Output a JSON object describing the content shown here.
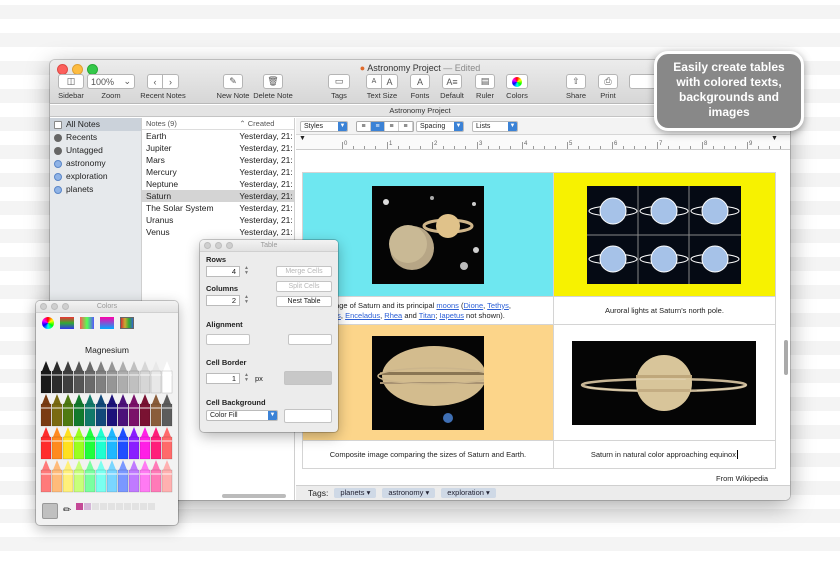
{
  "window": {
    "title": "Astronomy Project",
    "edited": "— Edited",
    "document_strip": "Astronomy Project"
  },
  "toolbar": {
    "sidebar_label": "Sidebar",
    "zoom_value": "100%",
    "zoom_label": "Zoom",
    "recent_label": "Recent Notes",
    "new_note_label": "New Note",
    "delete_note_label": "Delete Note",
    "tags_label": "Tags",
    "text_size_label": "Text Size",
    "fonts_label": "Fonts",
    "default_label": "Default",
    "ruler_label": "Ruler",
    "colors_label": "Colors",
    "share_label": "Share",
    "print_label": "Print"
  },
  "sidebar": {
    "items": [
      {
        "label": "All Notes",
        "icon": "notes-icon"
      },
      {
        "label": "Recents",
        "icon": "gear-icon"
      },
      {
        "label": "Untagged",
        "icon": "gear-icon"
      },
      {
        "label": "astronomy",
        "icon": "tag-icon"
      },
      {
        "label": "exploration",
        "icon": "tag-icon"
      },
      {
        "label": "planets",
        "icon": "tag-icon"
      }
    ]
  },
  "notes": {
    "header_name": "Notes (9)",
    "header_created": "Created",
    "rows": [
      {
        "name": "Earth",
        "created": "Yesterday, 21:"
      },
      {
        "name": "Jupiter",
        "created": "Yesterday, 21:"
      },
      {
        "name": "Mars",
        "created": "Yesterday, 21:"
      },
      {
        "name": "Mercury",
        "created": "Yesterday, 21:"
      },
      {
        "name": "Neptune",
        "created": "Yesterday, 21:"
      },
      {
        "name": "Saturn",
        "created": "Yesterday, 21:"
      },
      {
        "name": "The Solar System",
        "created": "Yesterday, 21:"
      },
      {
        "name": "Uranus",
        "created": "Yesterday, 21:"
      },
      {
        "name": "Venus",
        "created": "Yesterday, 21:"
      }
    ]
  },
  "format_bar": {
    "styles": "Styles",
    "spacing": "Spacing",
    "lists": "Lists"
  },
  "ruler": {
    "numbers": [
      "0",
      "1",
      "2",
      "3",
      "4",
      "5",
      "6",
      "7",
      "8",
      "9",
      "10"
    ]
  },
  "table": {
    "cell1_bg": "#6ee7f0",
    "cell2_bg": "#f7f200",
    "cell3_bg": "#fcd58a",
    "caption1_pre": "tage of Saturn and its principal ",
    "caption1_moons": "moons",
    "caption1_open": " (",
    "caption1_dione": "Dione",
    "caption1_comma1": ", ",
    "caption1_tethys": "Tethys",
    "caption1_comma2": ",",
    "caption1_mimas": "as",
    "caption1_comma3": ", ",
    "caption1_enceladus": "Enceladus",
    "caption1_comma4": ", ",
    "caption1_rhea": "Rhea",
    "caption1_and": " and ",
    "caption1_titan": "Titan",
    "caption1_semi": "; ",
    "caption1_iapetus": "Iapetus",
    "caption1_tail": " not shown).",
    "caption2": "Auroral lights at Saturn's north pole.",
    "caption3": "Composite image comparing the sizes of Saturn and Earth.",
    "caption4": "Saturn in natural color approaching equinox"
  },
  "from_wiki": "From Wikipedia",
  "tags_bar": {
    "label": "Tags:",
    "tags": [
      "planets",
      "astronomy",
      "exploration"
    ]
  },
  "table_panel": {
    "title": "Table",
    "rows_label": "Rows",
    "rows_value": "4",
    "columns_label": "Columns",
    "columns_value": "2",
    "merge_cells": "Merge Cells",
    "split_cells": "Split Cells",
    "nest_table": "Nest Table",
    "alignment_label": "Alignment",
    "cell_border_label": "Cell Border",
    "border_value": "1",
    "border_unit": "px",
    "cell_background_label": "Cell Background",
    "background_mode": "Color Fill"
  },
  "colors_panel": {
    "title": "Colors",
    "selected_color_name": "Magnesium",
    "selected_color": "#c0c0c0"
  },
  "callout": {
    "line1": "Easily create tables",
    "line2": "with colored texts,",
    "line3": "backgrounds and",
    "line4": "images"
  }
}
